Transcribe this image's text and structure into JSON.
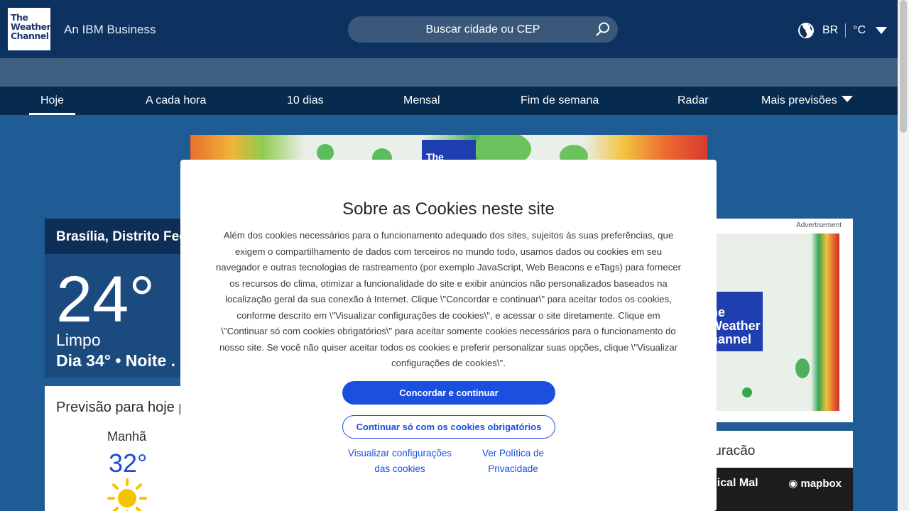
{
  "header": {
    "logo_lines": [
      "The",
      "Weather",
      "Channel"
    ],
    "tagline": "An IBM Business",
    "search_placeholder": "Buscar cidade ou CEP",
    "region": "BR",
    "unit": "°C"
  },
  "nav": {
    "items": [
      "Hoje",
      "A cada hora",
      "10 dias",
      "Mensal",
      "Fim de semana",
      "Radar",
      "Mais previsões"
    ],
    "active": "Hoje"
  },
  "banner": {
    "logo_text": "The"
  },
  "current": {
    "location": "Brasília, Distrito Fec",
    "temperature": "24°",
    "phrase": "Limpo",
    "hilo": "Dia 34° • Noite ."
  },
  "forecast": {
    "title": "Previsão para hoje p",
    "period": "Manhã",
    "temperature": "32°",
    "icon": "sun-icon"
  },
  "ad": {
    "label": "Advertisement",
    "logo_lines": [
      "he",
      "Weather",
      "hannel"
    ]
  },
  "hurricane": {
    "title": "furacão",
    "map_label": "pical Mal",
    "map_brand": "mapbox"
  },
  "cookie_modal": {
    "title": "Sobre as Cookies neste site",
    "body": "Além dos cookies necessários para o funcionamento adequado dos sites, sujeitos às suas preferências, que exigem o compartilhamento de dados com terceiros no mundo todo, usamos dados ou cookies em seu navegador e outras tecnologias de rastreamento (por exemplo JavaScript, Web Beacons e eTags) para fornecer os recursos do clima, otimizar a funcionalidade do site e exibir anúncios não personalizados baseados na localização geral da sua conexão à Internet. Clique \\\"Concordar e continuar\\\" para aceitar todos os cookies, conforme descrito em \\\"Visualizar configurações de cookies\\\", e acessar o site diretamente. Clique em \\\"Continuar só com cookies obrigatórios\\\" para aceitar somente cookies necessários para o funcionamento do nosso site. Se você não quiser aceitar todos os cookies e preferir personalizar suas opções, clique \\\"Visualizar configurações de cookies\\\".",
    "accept_label": "Concordar e continuar",
    "required_only_label": "Continuar só com os cookies obrigatórios",
    "settings_link": "Visualizar configurações das cookies",
    "privacy_link": "Ver Política de Privacidade"
  },
  "colors": {
    "header_bg": "#0e3260",
    "nav_bg": "#062b4f",
    "page_bg": "#1f5b94",
    "accent_blue": "#1a4fe0"
  }
}
